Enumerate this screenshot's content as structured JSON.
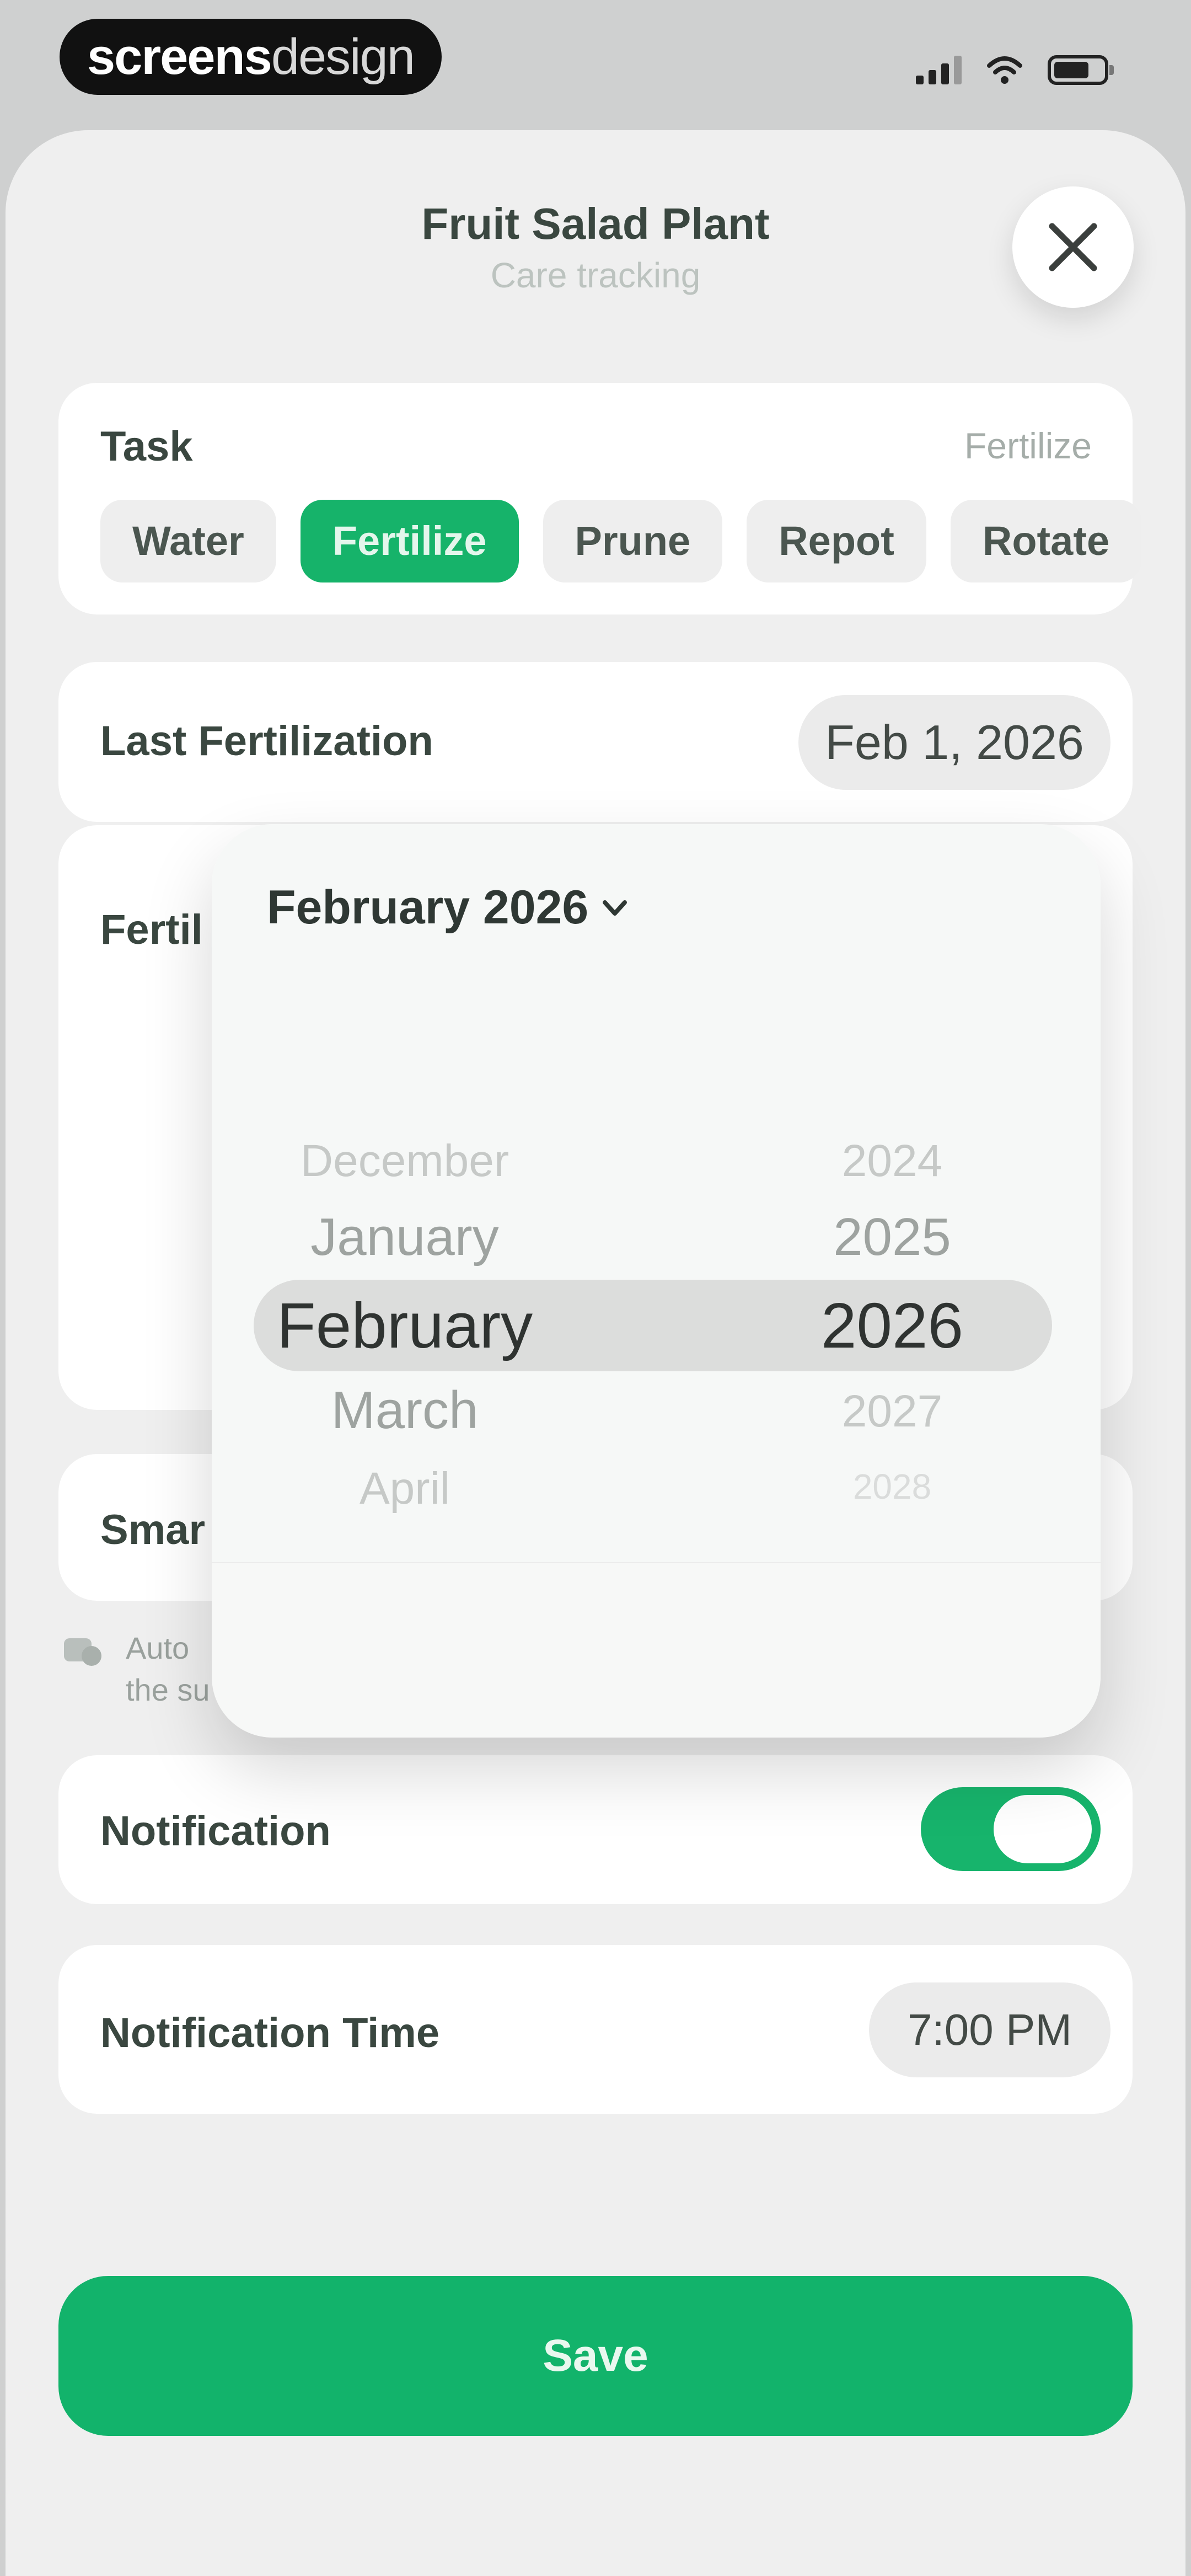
{
  "status_bar": {
    "brand_bold": "screens",
    "brand_light": "design"
  },
  "header": {
    "title": "Fruit Salad Plant",
    "subtitle": "Care tracking",
    "close_icon": "close-icon"
  },
  "task": {
    "label": "Task",
    "selected_value": "Fertilize",
    "chips": [
      "Water",
      "Fertilize",
      "Prune",
      "Repot",
      "Rotate"
    ],
    "active_index": 1
  },
  "last_fertilization": {
    "label": "Last Fertilization",
    "value": "Feb 1, 2026"
  },
  "fertilize_interval": {
    "label_partial": "Fertil"
  },
  "smart": {
    "label_partial": "Smar",
    "footnote_partial": "Auto\nthe su"
  },
  "notification": {
    "label": "Notification",
    "enabled": true
  },
  "notification_time": {
    "label": "Notification Time",
    "value": "7:00 PM"
  },
  "save": {
    "label": "Save"
  },
  "date_picker": {
    "header": "February 2026",
    "months": [
      "December",
      "January",
      "February",
      "March",
      "April"
    ],
    "years": [
      "2024",
      "2025",
      "2026",
      "2027",
      "2028"
    ],
    "selected_index": 2
  },
  "colors": {
    "accent": "#16b36a",
    "background": "#efefef",
    "card": "#ffffff"
  }
}
